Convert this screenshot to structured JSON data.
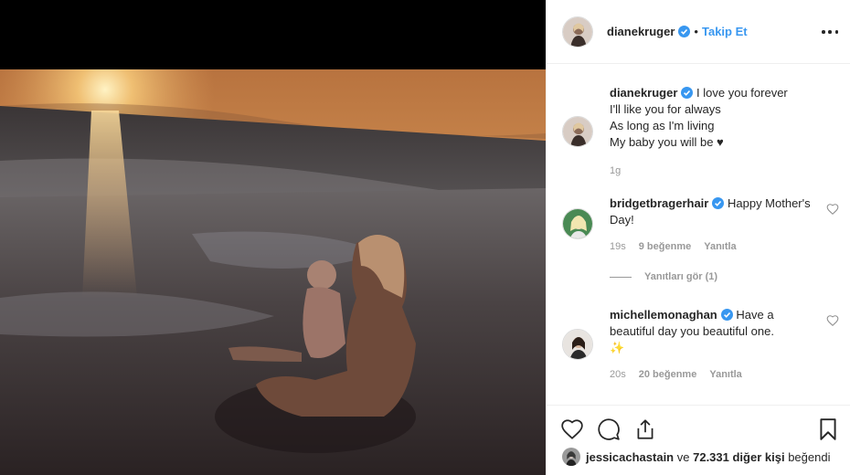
{
  "post": {
    "photo_alt": "",
    "author": {
      "username": "dianekruger",
      "verified": true,
      "follow_label": "Takip Et",
      "separator": "•"
    },
    "more_icon": "more-options-icon"
  },
  "caption": {
    "username": "dianekruger",
    "line1": "I love you forever",
    "line2": "I'll like you for always",
    "line3": "As long as I'm living",
    "line4": "My baby you will be ♥",
    "time": "1g"
  },
  "comments": [
    {
      "username": "bridgetbragerhair",
      "text": "Happy Mother's Day!",
      "time": "19s",
      "likes": "9 beğenme",
      "reply_label": "Yanıtla",
      "view_replies": "Yanıtları gör (1)"
    },
    {
      "username": "michellemonaghan",
      "text": "Have a beautiful day you beautiful one.",
      "emoji": "✨",
      "time": "20s",
      "likes": "20 beğenme",
      "reply_label": "Yanıtla"
    }
  ],
  "actions": {
    "like_icon": "heart-icon",
    "comment_icon": "comment-icon",
    "share_icon": "share-icon",
    "save_icon": "bookmark-icon"
  },
  "liked_by": {
    "username": "jessicachastain",
    "conjunction": "ve",
    "others": "72.331 diğer kişi",
    "suffix": "beğendi"
  },
  "colors": {
    "link": "#3897f0",
    "verified": "#3897f0",
    "muted": "#999999",
    "text": "#262626"
  }
}
